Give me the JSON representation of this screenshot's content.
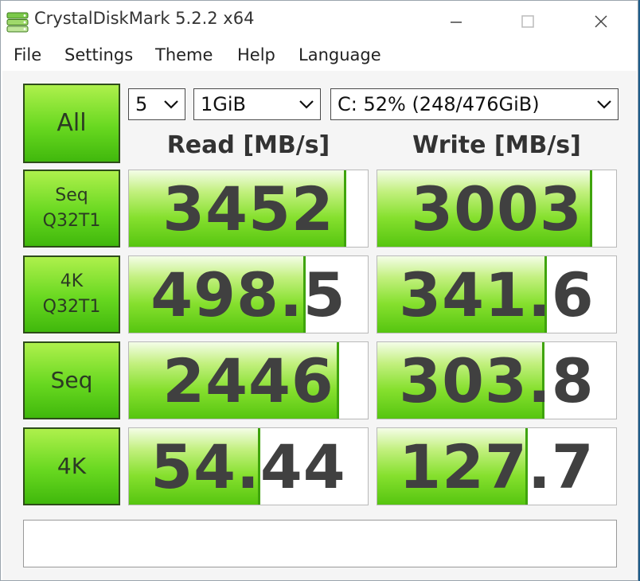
{
  "window": {
    "title": "CrystalDiskMark 5.2.2 x64"
  },
  "menu": [
    "File",
    "Settings",
    "Theme",
    "Help",
    "Language"
  ],
  "controls": {
    "all_label": "All",
    "count": "5",
    "size": "1GiB",
    "drive": "C: 52% (248/476GiB)"
  },
  "headers": {
    "read": "Read [MB/s]",
    "write": "Write [MB/s]"
  },
  "tests": [
    {
      "label": "Seq\nQ32T1",
      "read": "3452",
      "write": "3003",
      "read_fill": 0.9,
      "write_fill": 0.89
    },
    {
      "label": "4K\nQ32T1",
      "read": "498.5",
      "write": "341.6",
      "read_fill": 0.73,
      "write_fill": 0.7
    },
    {
      "label": "Seq",
      "read": "2446",
      "write": "303.8",
      "read_fill": 0.87,
      "write_fill": 0.69
    },
    {
      "label": "4K",
      "read": "54.44",
      "write": "127.7",
      "read_fill": 0.54,
      "write_fill": 0.62
    }
  ],
  "comment": "",
  "colors": {
    "bar_green": "#56c510",
    "button_green": "#68d820",
    "value_text": "#404040"
  }
}
